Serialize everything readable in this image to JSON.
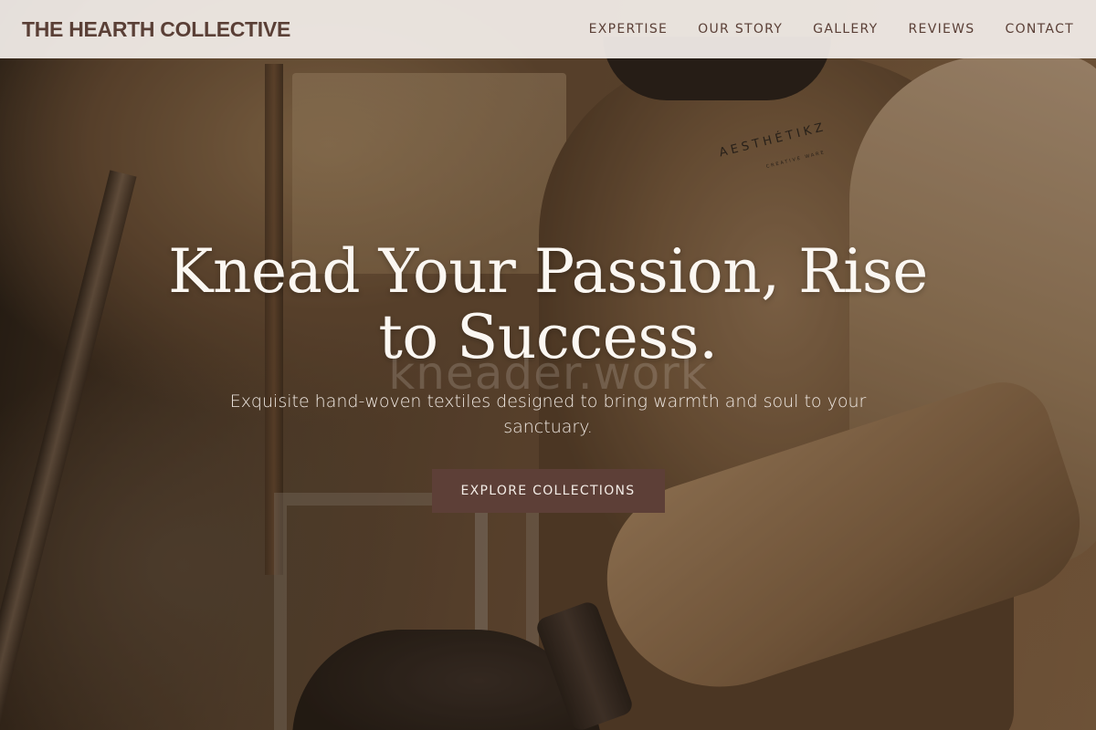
{
  "brand": {
    "name": "THE HEARTH COLLECTIVE"
  },
  "nav": {
    "items": [
      {
        "label": "EXPERTISE"
      },
      {
        "label": "OUR STORY"
      },
      {
        "label": "GALLERY"
      },
      {
        "label": "REVIEWS"
      },
      {
        "label": "CONTACT"
      }
    ]
  },
  "hero": {
    "title": "Knead Your Passion, Rise to Success.",
    "watermark": "kneader.work",
    "subtitle": "Exquisite hand-woven textiles designed to bring warmth and soul to your sanctuary.",
    "cta_label": "EXPLORE COLLECTIONS",
    "shirt_logo": "AESTHÉTIKZ",
    "shirt_logo_sub": "CREATIVE WARE"
  },
  "colors": {
    "brand_text": "#5a3f36",
    "header_bg": "#f1ece8",
    "cta_bg": "#5d3f37",
    "hero_text": "#fbf7f2"
  }
}
